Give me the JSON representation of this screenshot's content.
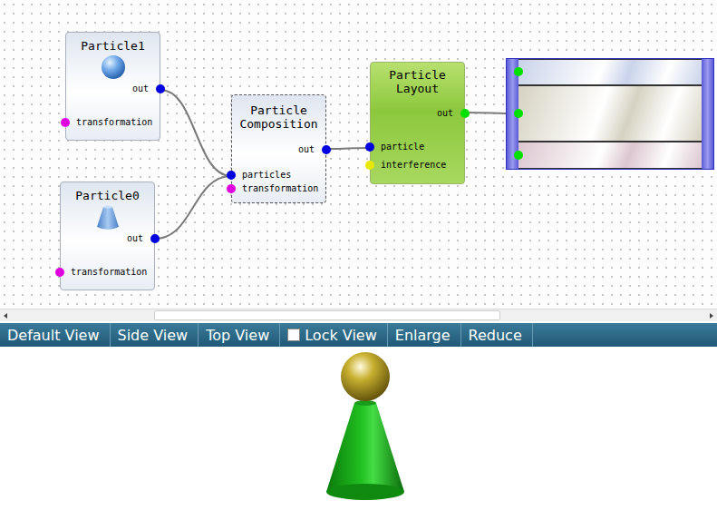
{
  "nodes": [
    {
      "title": "Particle1",
      "kind": "sphere",
      "ports": [
        {
          "label": "out",
          "side": "right",
          "color": "#0000e0"
        },
        {
          "label": "transformation",
          "side": "left",
          "color": "#e000e0"
        }
      ]
    },
    {
      "title": "Particle0",
      "kind": "cone",
      "ports": [
        {
          "label": "out",
          "side": "right",
          "color": "#0000e0"
        },
        {
          "label": "transformation",
          "side": "left",
          "color": "#e000e0"
        }
      ]
    },
    {
      "title": "Particle Composition",
      "kind": "composition",
      "ports": [
        {
          "label": "out",
          "side": "right",
          "color": "#0000e0"
        },
        {
          "label": "particles",
          "side": "left",
          "color": "#0000e0"
        },
        {
          "label": "transformation",
          "side": "left",
          "color": "#e000e0"
        }
      ]
    },
    {
      "title": "Particle Layout",
      "kind": "layout",
      "ports": [
        {
          "label": "out",
          "side": "right",
          "color": "#00e000"
        },
        {
          "label": "particle",
          "side": "left",
          "color": "#0000e0"
        },
        {
          "label": "interference",
          "side": "left",
          "color": "#e8e800"
        }
      ]
    }
  ],
  "multilayer": {
    "layers": [
      {
        "color": "#c9d3ea"
      },
      {
        "color": "#d6d2c2"
      },
      {
        "color": "#dcc6cf"
      }
    ]
  },
  "links": [
    {
      "from": "Particle1",
      "to": "Particle Composition"
    },
    {
      "from": "Particle0",
      "to": "Particle Composition"
    },
    {
      "from": "Particle Composition",
      "to": "Particle Layout"
    },
    {
      "from": "Particle Layout",
      "to": "multilayer"
    }
  ],
  "toolbar": [
    {
      "label": "Default View",
      "kind": "button"
    },
    {
      "label": "Side View",
      "kind": "button"
    },
    {
      "label": "Top View",
      "kind": "button"
    },
    {
      "label": "Lock View",
      "kind": "checkbox",
      "checked": false
    },
    {
      "label": "Enlarge",
      "kind": "button"
    },
    {
      "label": "Reduce",
      "kind": "button"
    }
  ]
}
